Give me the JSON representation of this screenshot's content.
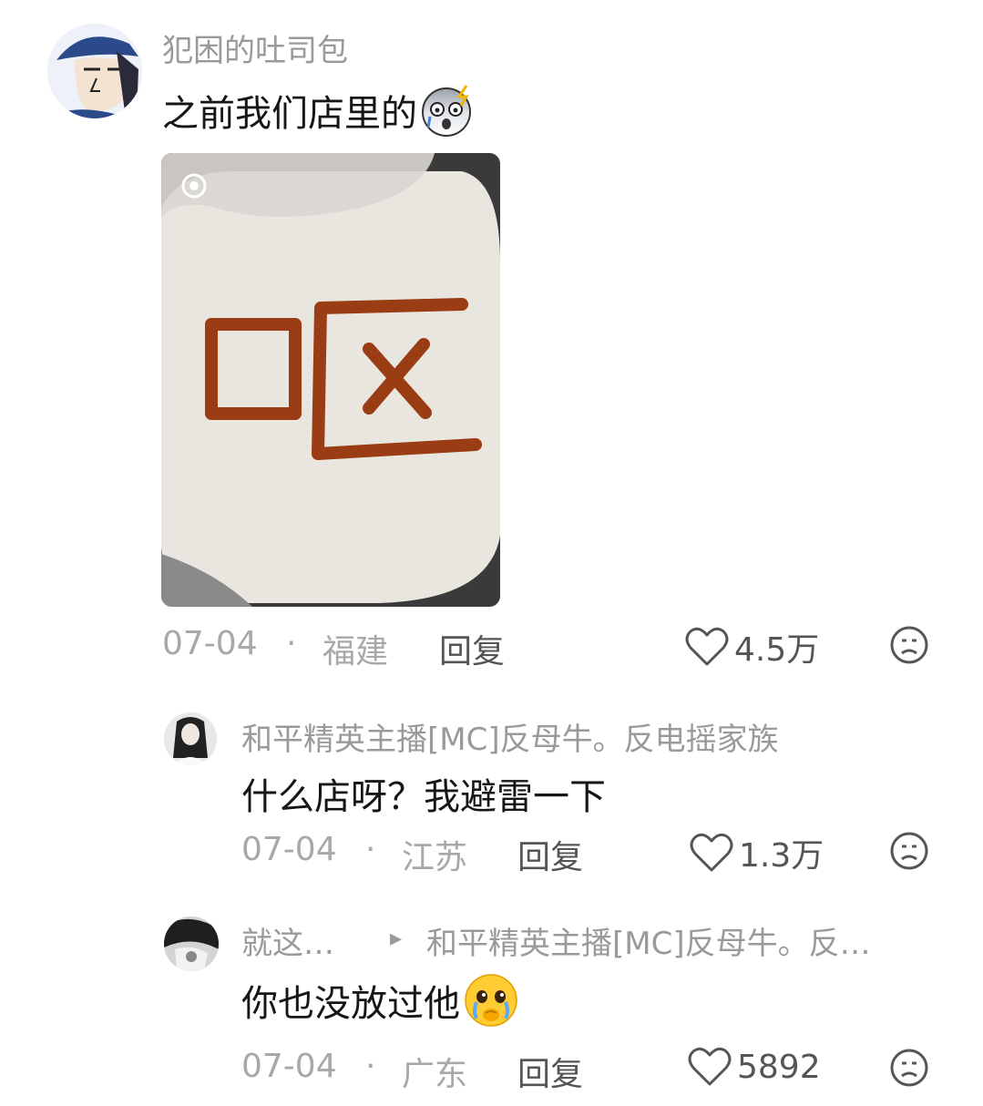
{
  "comments": [
    {
      "username": "犯困的吐司包",
      "text": "之前我们店里的",
      "emoji": "fearful-face",
      "image": "photo-plate-sauce-writing",
      "date": "07-04",
      "sep": "·",
      "location": "福建",
      "reply_label": "回复",
      "likes": "4.5万"
    },
    {
      "username": "和平精英主播[MC]反母牛。反电摇家族",
      "text": "什么店呀？我避雷一下",
      "date": "07-04",
      "sep": "·",
      "location": "江苏",
      "reply_label": "回复",
      "likes": "1.3万"
    },
    {
      "username": "就这…",
      "reply_to_arrow": "▸",
      "reply_to": "和平精英主播[MC]反母牛。反…",
      "text": "你也没放过他",
      "emoji": "crying-face",
      "date": "07-04",
      "sep": "·",
      "location": "广东",
      "reply_label": "回复",
      "likes": "5892"
    }
  ],
  "colors": {
    "username": "#9a9a9a",
    "content": "#161616",
    "meta": "#a8a8a8",
    "action": "#555555"
  }
}
